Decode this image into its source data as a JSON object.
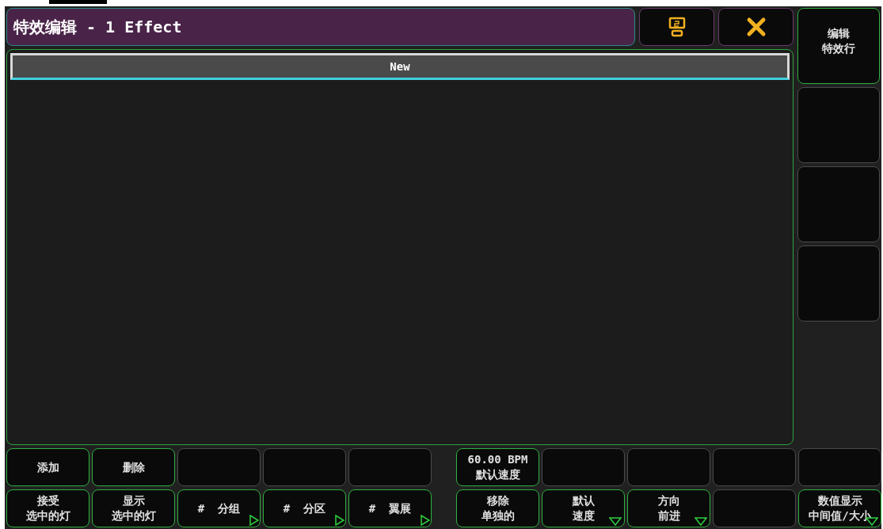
{
  "window": {
    "title": "特效编辑 - 1 Effect"
  },
  "list": {
    "header": "New"
  },
  "side_buttons": [
    {
      "lines": [
        "编辑",
        "特效行"
      ],
      "active": true
    },
    {
      "active": false
    },
    {
      "active": false
    },
    {
      "active": false
    }
  ],
  "bottom_rows": [
    [
      {
        "lines": [
          "添加"
        ],
        "active": true
      },
      {
        "lines": [
          "删除"
        ],
        "active": true
      },
      {
        "active": false
      },
      {
        "active": false
      },
      {
        "active": false
      },
      {
        "lines": [
          "60.00 BPM",
          "默认速度"
        ],
        "active": true
      },
      {
        "active": false
      },
      {
        "active": false
      },
      {
        "active": false
      },
      {
        "active": false
      }
    ],
    [
      {
        "lines": [
          "接受",
          "选中的灯"
        ],
        "active": true
      },
      {
        "lines": [
          "显示",
          "选中的灯"
        ],
        "active": true
      },
      {
        "lines": [
          "#  分组"
        ],
        "active": true,
        "kind": "submenu"
      },
      {
        "lines": [
          "#  分区"
        ],
        "active": true,
        "kind": "submenu"
      },
      {
        "lines": [
          "#  翼展"
        ],
        "active": true,
        "kind": "submenu"
      },
      {
        "lines": [
          "移除",
          "单独的"
        ],
        "active": true
      },
      {
        "lines": [
          "默认",
          "速度"
        ],
        "active": true,
        "kind": "dropdown"
      },
      {
        "lines": [
          "方向",
          "前进"
        ],
        "active": true,
        "kind": "dropdown"
      },
      {
        "active": false
      },
      {
        "lines": [
          "数值显示",
          "中间值/大小"
        ],
        "active": true,
        "kind": "dropdown"
      }
    ]
  ]
}
